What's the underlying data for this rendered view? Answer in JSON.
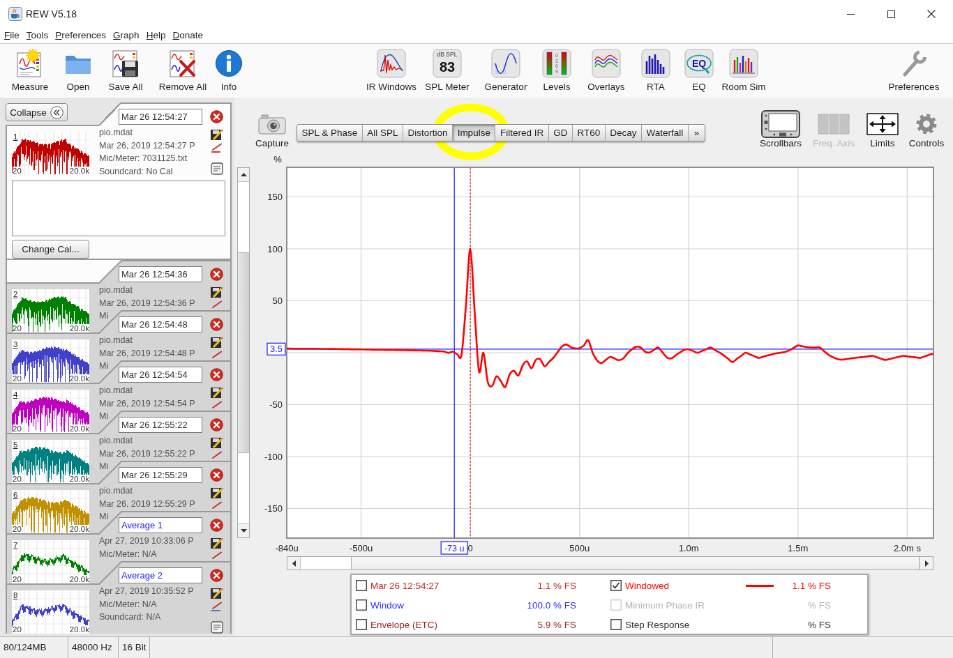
{
  "window": {
    "title": "REW V5.18"
  },
  "menu": [
    "File",
    "Tools",
    "Preferences",
    "Graph",
    "Help",
    "Donate"
  ],
  "toolbar": {
    "left": [
      {
        "kind": "measure",
        "label": "Measure"
      },
      {
        "kind": "open",
        "label": "Open"
      },
      {
        "kind": "save-all",
        "label": "Save All"
      },
      {
        "kind": "remove-all",
        "label": "Remove All"
      },
      {
        "kind": "info",
        "label": "Info"
      }
    ],
    "center": [
      {
        "kind": "ir-windows",
        "label": "IR Windows"
      },
      {
        "kind": "spl-meter",
        "label": "SPL Meter",
        "icon_text": [
          "dB SPL",
          "83"
        ]
      },
      {
        "kind": "generator",
        "label": "Generator"
      },
      {
        "kind": "levels",
        "label": "Levels",
        "icon_text": [
          "0",
          "3",
          "6",
          "9"
        ]
      },
      {
        "kind": "overlays",
        "label": "Overlays"
      },
      {
        "kind": "rta",
        "label": "RTA"
      },
      {
        "kind": "eq",
        "label": "EQ",
        "icon_text": [
          "EQ"
        ]
      },
      {
        "kind": "room-sim",
        "label": "Room Sim"
      }
    ],
    "right": [
      {
        "kind": "preferences",
        "label": "Preferences"
      }
    ]
  },
  "measurements": {
    "collapse_button": "Collapse",
    "change_cal_button": "Change Cal...",
    "items": [
      {
        "kind": "measurement",
        "selected": true,
        "name": "Mar 26 12:54:27",
        "index": "1",
        "axis_start": "20",
        "axis_end": "20.0k",
        "color": "#c00000",
        "lines": [
          "pio.mdat",
          "Mar 26, 2019 12:54:27 P",
          "Mic/Meter: 7031125.txt",
          "Soundcard: No Cal"
        ]
      },
      {
        "kind": "measurement",
        "selected": false,
        "name": "Mar 26 12:54:36",
        "index": "2",
        "axis_start": "20",
        "axis_end": "20.0k",
        "color": "#008000",
        "lines": [
          "pio.mdat",
          "Mar 26, 2019 12:54:36 P",
          "Mi"
        ]
      },
      {
        "kind": "measurement",
        "selected": false,
        "name": "Mar 26 12:54:48",
        "index": "3",
        "axis_start": "20",
        "axis_end": "20.0k",
        "color": "#4040c8",
        "lines": [
          "pio.mdat",
          "Mar 26, 2019 12:54:48 P",
          "Mi"
        ]
      },
      {
        "kind": "measurement",
        "selected": false,
        "name": "Mar 26 12:54:54",
        "index": "4",
        "axis_start": "20",
        "axis_end": "20.0k",
        "color": "#c000c0",
        "lines": [
          "pio.mdat",
          "Mar 26, 2019 12:54:54 P",
          "Mi"
        ]
      },
      {
        "kind": "measurement",
        "selected": false,
        "name": "Mar 26 12:55:22",
        "index": "5",
        "axis_start": "20",
        "axis_end": "20.0k",
        "color": "#008080",
        "lines": [
          "pio.mdat",
          "Mar 26, 2019 12:55:22 P",
          "Mi"
        ]
      },
      {
        "kind": "measurement",
        "selected": false,
        "name": "Mar 26 12:55:29",
        "index": "6",
        "axis_start": "20",
        "axis_end": "20.0k",
        "color": "#c09000",
        "lines": [
          "pio.mdat",
          "Mar 26, 2019 12:55:29 P",
          "Mi"
        ]
      },
      {
        "kind": "average",
        "selected": false,
        "name": "Average 1",
        "index": "7",
        "axis_start": "20",
        "axis_end": "20.0k",
        "color": "#008000",
        "lines": [
          "Apr 27, 2019 10:33:06 P",
          "Mic/Meter: N/A"
        ]
      },
      {
        "kind": "average",
        "selected": false,
        "name": "Average 2",
        "index": "8",
        "axis_start": "20",
        "axis_end": "20.0k",
        "color": "#4040c8",
        "lines": [
          "Apr 27, 2019 10:35:52 P",
          "Mic/Meter: N/A",
          "Soundcard: N/A"
        ]
      }
    ]
  },
  "graph": {
    "capture_button": "Capture",
    "tabs": [
      {
        "label": "SPL & Phase",
        "selected": false
      },
      {
        "label": "All SPL",
        "selected": false
      },
      {
        "label": "Distortion",
        "selected": false
      },
      {
        "label": "Impulse",
        "selected": true
      },
      {
        "label": "Filtered IR",
        "selected": false
      },
      {
        "label": "GD",
        "selected": false
      },
      {
        "label": "RT60",
        "selected": false
      },
      {
        "label": "Decay",
        "selected": false
      },
      {
        "label": "Waterfall",
        "selected": false
      }
    ],
    "more_button": "»",
    "controls": [
      {
        "kind": "scrollbars",
        "label": "Scrollbars",
        "disabled": false
      },
      {
        "kind": "freq-axis",
        "label": "Freq. Axis",
        "disabled": true
      },
      {
        "kind": "limits",
        "label": "Limits",
        "disabled": false
      },
      {
        "kind": "controls",
        "label": "Controls",
        "disabled": false
      }
    ],
    "x_cursor_readout": "-73 u",
    "chart_data": {
      "type": "line",
      "ylabel": "%",
      "grid": true,
      "categories": [
        "-840u",
        null,
        null,
        null,
        null,
        null,
        null,
        null,
        null,
        null,
        null,
        null,
        null,
        null,
        null,
        null,
        null,
        "-500u",
        null,
        null,
        null,
        null,
        null,
        null,
        null,
        null,
        null,
        null,
        null,
        null,
        null,
        null,
        null,
        null,
        null,
        null,
        null,
        null,
        null,
        null,
        null,
        null,
        "0",
        null,
        null,
        null,
        null,
        null,
        null,
        null,
        null,
        null,
        null,
        null,
        null,
        null,
        null,
        null,
        null,
        null,
        null,
        null,
        null,
        null,
        null,
        null,
        null,
        "500u",
        null,
        null,
        null,
        null,
        null,
        null,
        null,
        null,
        null,
        null,
        null,
        null,
        null,
        null,
        null,
        null,
        null,
        null,
        null,
        null,
        null,
        null,
        null,
        null,
        "1.0m",
        null,
        null,
        null,
        null,
        null,
        null,
        null,
        null,
        null,
        null,
        null,
        null,
        null,
        null,
        null,
        null,
        null,
        null,
        null,
        null,
        null,
        null,
        null,
        null,
        "1.5m",
        null,
        null,
        null,
        null,
        null,
        null,
        null,
        null,
        null,
        null,
        null,
        null,
        null,
        null,
        null,
        null,
        null,
        null,
        null,
        null,
        null,
        null,
        null,
        null,
        "2.0m s",
        null,
        null,
        null,
        null,
        null,
        null
      ],
      "ylim": [
        -178.5,
        178.5
      ],
      "yticks": [
        150,
        100,
        50,
        -50,
        -100,
        -150
      ],
      "series": [
        {
          "color": "#ff0000",
          "values": [
            4.0,
            4.0,
            3.9,
            3.9,
            3.9,
            3.9,
            3.8,
            3.8,
            3.7,
            3.7,
            3.6,
            3.6,
            3.5,
            3.4,
            3.4,
            3.3,
            3.3,
            3.2,
            3.1,
            3.0,
            2.9,
            2.9,
            2.8,
            2.7,
            2.7,
            2.6,
            2.6,
            2.5,
            2.4,
            2.3,
            2.2,
            2.1,
            2.0,
            1.8,
            1.6,
            1.4,
            1.2,
            -0.2,
            1.0,
            -1.5,
            -2,
            45,
            100,
            40,
            -18,
            0,
            -28,
            -32,
            -22.7,
            -27.5,
            -33,
            -21,
            -17.5,
            -22,
            -12.2,
            -8.3,
            -15,
            -7,
            -6.3,
            -13,
            -9,
            -5,
            0.5,
            6,
            8,
            5.3,
            4.1,
            4.4,
            7,
            12,
            0,
            -7.3,
            -10,
            -7,
            -4,
            -5.6,
            -7.2,
            -5.5,
            -0.5,
            3.3,
            5.8,
            5,
            1,
            0.2,
            2.6,
            5,
            0.2,
            -4.6,
            -5.5,
            -2.5,
            0.3,
            2.8,
            3.2,
            1.6,
            0,
            1.7,
            3.3,
            5,
            2.6,
            0.2,
            -2.6,
            -5.8,
            -9,
            -6,
            -3,
            0,
            -1.7,
            -3.3,
            -5,
            -3.9,
            -2.7,
            -1.6,
            -0.7,
            0,
            0.7,
            2.2,
            4.6,
            7,
            6.2,
            5.4,
            5,
            5,
            5,
            1.4,
            -2.1,
            -4.3,
            -6.1,
            -6.7,
            -6.1,
            -5.6,
            -5,
            -4.5,
            -4,
            -3.5,
            -3,
            -4.3,
            -5.7,
            -7,
            -6,
            -5,
            -4,
            -3,
            -3.5,
            -4,
            -4.5,
            -5,
            -3.5,
            -2.1,
            -1
          ]
        }
      ],
      "ref_lines": [
        {
          "axis": "x",
          "value": "0",
          "color": "#ff0000"
        },
        {
          "axis": "y",
          "value": 3.5,
          "label": "3.5",
          "color": "#1a1aff"
        }
      ]
    },
    "legend": [
      {
        "label": "Mar 26 12:54:27",
        "value": "1.1 % FS",
        "color": "#cc2222",
        "checked": false,
        "disabled": false
      },
      {
        "label": "Windowed",
        "value": "1.1 % FS",
        "color": "#ff0000",
        "checked": true,
        "disabled": false
      },
      {
        "label": "Window",
        "value": "100.0 % FS",
        "color": "#2b2bff",
        "checked": false,
        "disabled": false
      },
      {
        "label": "Minimum Phase IR",
        "value": "% FS",
        "color": "#b4b4b4",
        "checked": false,
        "disabled": true
      },
      {
        "label": "Envelope (ETC)",
        "value": "5.9 % FS",
        "color": "#9a1f1f",
        "checked": false,
        "disabled": false
      },
      {
        "label": "Step Response",
        "value": "% FS",
        "color": "#333333",
        "checked": false,
        "disabled": false
      }
    ]
  },
  "status_bar": [
    "80/124MB",
    "48000 Hz",
    "16 Bit"
  ]
}
